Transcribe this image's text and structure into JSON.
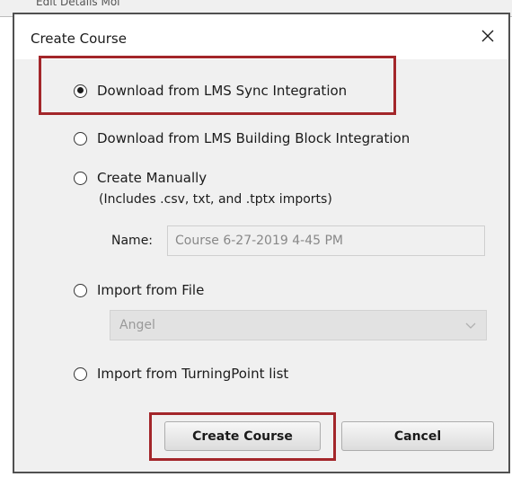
{
  "background": {
    "truncated_text": "Edit Details Mol"
  },
  "dialog": {
    "title": "Create Course",
    "close_glyph": "✕"
  },
  "options": [
    {
      "label": "Download from LMS Sync Integration",
      "checked": true
    },
    {
      "label": "Download from LMS Building Block Integration",
      "checked": false
    },
    {
      "label": "Create Manually",
      "checked": false
    },
    {
      "label": "Import from File",
      "checked": false
    },
    {
      "label": "Import from TurningPoint list",
      "checked": false
    }
  ],
  "manual": {
    "note": "(Includes .csv, txt, and .tptx imports)",
    "name_label": "Name:",
    "name_value": "Course 6-27-2019 4-45 PM"
  },
  "import_file": {
    "selected": "Angel"
  },
  "buttons": {
    "create": "Create Course",
    "cancel": "Cancel"
  },
  "colors": {
    "highlight": "#a3262a",
    "dialog_bg": "#f0f0f0"
  }
}
